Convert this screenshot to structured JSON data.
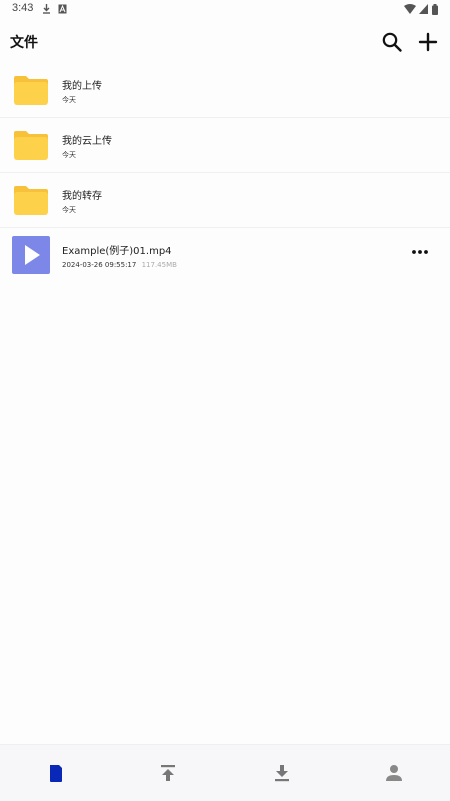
{
  "status_bar": {
    "time": "3:43",
    "icons": [
      "download-icon",
      "a-icon",
      "wifi-icon",
      "signal-icon",
      "battery-icon"
    ]
  },
  "header": {
    "title": "文件",
    "actions": [
      "search-icon",
      "plus-icon"
    ]
  },
  "files": {
    "folders": [
      {
        "name": "我的上传",
        "date": "今天",
        "icon": "folder-icon"
      },
      {
        "name": "我的云上传",
        "date": "今天",
        "icon": "folder-icon"
      },
      {
        "name": "我的转存",
        "date": "今天",
        "icon": "folder-icon"
      }
    ],
    "video": {
      "name": "Example(例子)01.mp4",
      "timestamp": "2024-03-26 09:55:17",
      "size": "117.45MB",
      "icon": "play-icon"
    }
  },
  "tabbar": {
    "tabs": [
      {
        "name": "files",
        "icon": "file-icon",
        "active": true
      },
      {
        "name": "upload",
        "icon": "upload-icon",
        "active": false
      },
      {
        "name": "download",
        "icon": "download-icon",
        "active": false
      },
      {
        "name": "profile",
        "icon": "person-icon",
        "active": false
      }
    ]
  },
  "colors": {
    "folder": "#fdd24a",
    "folder_back": "#f8c13a",
    "video_thumb": "#7c87e8",
    "active_tab": "#0a28b8",
    "inactive_tab": "#777777"
  }
}
